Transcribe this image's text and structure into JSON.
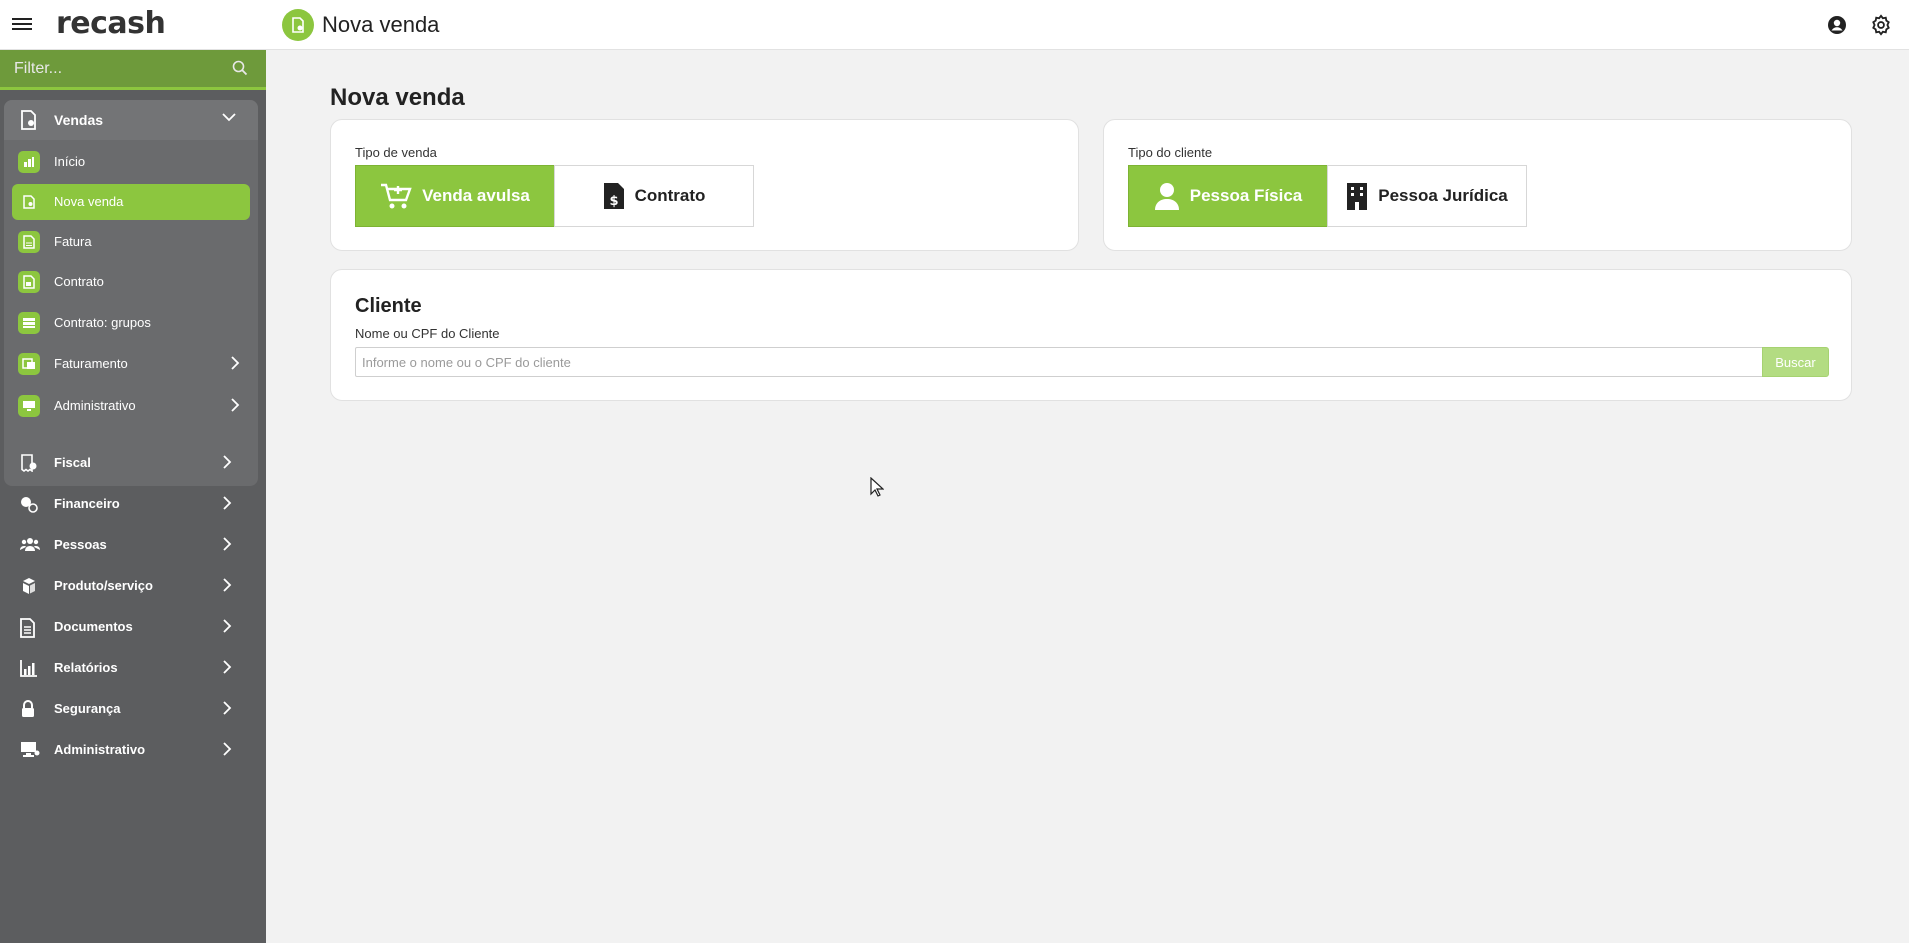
{
  "app": {
    "logo": "recash",
    "page_title": "Nova venda"
  },
  "sidebar": {
    "filter_placeholder": "Filter...",
    "group": {
      "label": "Vendas",
      "items": [
        {
          "label": "Início"
        },
        {
          "label": "Nova venda",
          "active": true
        },
        {
          "label": "Fatura"
        },
        {
          "label": "Contrato"
        },
        {
          "label": "Contrato: grupos"
        },
        {
          "label": "Faturamento",
          "has_children": true
        },
        {
          "label": "Administrativo",
          "has_children": true
        }
      ]
    },
    "items": [
      {
        "label": "Fiscal",
        "icon": "receipt-icon"
      },
      {
        "label": "Financeiro",
        "icon": "money-icon"
      },
      {
        "label": "Pessoas",
        "icon": "people-icon"
      },
      {
        "label": "Produto/serviço",
        "icon": "boxes-icon"
      },
      {
        "label": "Documentos",
        "icon": "documents-icon"
      },
      {
        "label": "Relatórios",
        "icon": "chart-icon"
      },
      {
        "label": "Segurança",
        "icon": "lock-icon"
      },
      {
        "label": "Administrativo",
        "icon": "admin-icon"
      }
    ]
  },
  "main": {
    "title": "Nova venda",
    "tipo_venda": {
      "label": "Tipo de venda",
      "options": [
        {
          "label": "Venda avulsa",
          "selected": true,
          "icon": "cart-plus-icon"
        },
        {
          "label": "Contrato",
          "selected": false,
          "icon": "invoice-dollar-icon"
        }
      ]
    },
    "tipo_cliente": {
      "label": "Tipo do cliente",
      "options": [
        {
          "label": "Pessoa Física",
          "selected": true,
          "icon": "person-icon"
        },
        {
          "label": "Pessoa Jurídica",
          "selected": false,
          "icon": "building-icon"
        }
      ]
    },
    "cliente": {
      "title": "Cliente",
      "field_label": "Nome ou CPF do Cliente",
      "placeholder": "Informe o nome ou o CPF do cliente",
      "value": "",
      "button_label": "Buscar"
    }
  },
  "colors": {
    "accent": "#8cc63f",
    "sidebar_bg": "#5c5d5f",
    "filter_bg": "#6e9a3b"
  }
}
